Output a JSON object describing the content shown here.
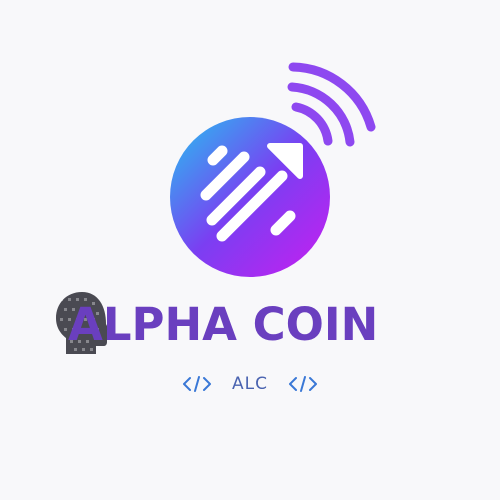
{
  "brand": {
    "name": "ALPHA COIN",
    "ticker": "ALC"
  },
  "colors": {
    "background": "#f8f8fa",
    "circle_gradient_start": "#25c3f0",
    "circle_gradient_mid": "#7a3ff2",
    "circle_gradient_end": "#c81ef0",
    "signal_waves": "#8e48f0",
    "wordmark": "#6a3fbf",
    "ticker": "#4a63b0",
    "code_icon": "#3a78d6"
  },
  "icons": {
    "logo": "coin-signal-arrow-icon",
    "silhouette": "head-silhouette-icon",
    "code_left": "code-brackets-icon",
    "code_right": "code-brackets-icon"
  }
}
